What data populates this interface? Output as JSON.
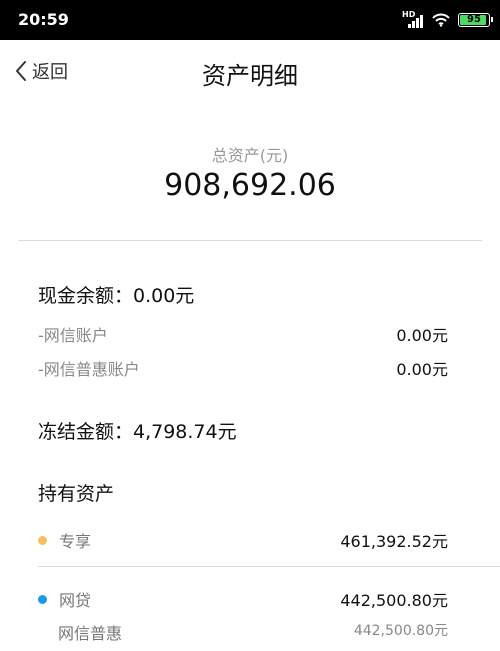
{
  "status_bar": {
    "time": "20:59",
    "network": "HD",
    "battery": "95"
  },
  "header": {
    "back_label": "返回",
    "title": "资产明细"
  },
  "summary": {
    "total_label": "总资产(元)",
    "total_value": "908,692.06"
  },
  "cash": {
    "heading": "现金余额：0.00元",
    "rows": [
      {
        "label": "-网信账户",
        "value": "0.00元"
      },
      {
        "label": "-网信普惠账户",
        "value": "0.00元"
      }
    ]
  },
  "frozen": {
    "heading": "冻结金额：4,798.74元"
  },
  "holdings": {
    "heading": "持有资产",
    "items": [
      {
        "name": "专享",
        "amount": "461,392.52元",
        "dot_color": "#f5c05a"
      },
      {
        "name": "网贷",
        "amount": "442,500.80元",
        "dot_color": "#1a9ae6"
      }
    ],
    "sub_items": [
      {
        "name": "网信普惠",
        "amount": "442,500.80元"
      }
    ]
  }
}
